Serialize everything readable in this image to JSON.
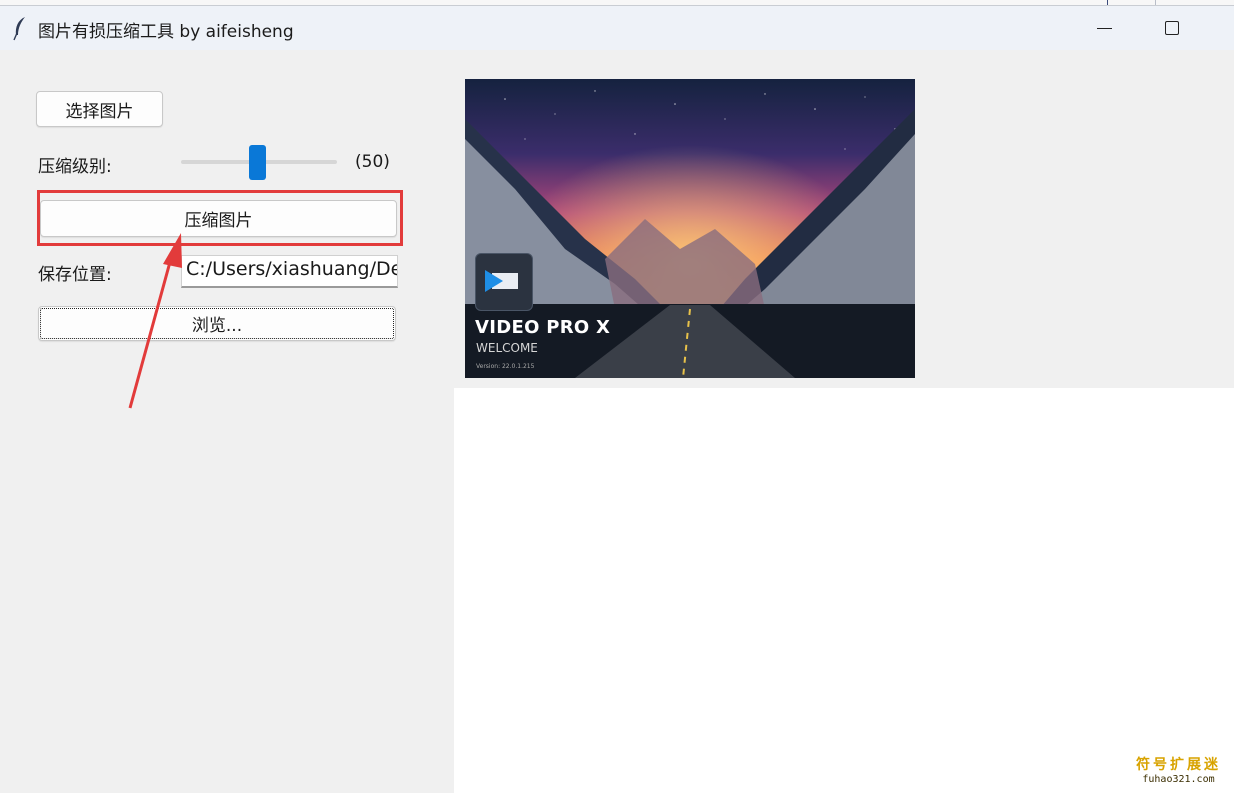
{
  "window": {
    "title": "图片有损压缩工具 by aifeisheng",
    "icon": "feather-icon"
  },
  "controls": {
    "select_button": "选择图片",
    "level_label": "压缩级别:",
    "level_value": "(50)",
    "level_fraction": 0.5,
    "compress_button": "压缩图片",
    "save_label": "保存位置:",
    "save_path": "C:/Users/xiashuang/Des",
    "browse_button": "浏览..."
  },
  "preview": {
    "title": "VIDEO PRO X",
    "subtitle": "WELCOME",
    "version": "Version: 22.0.1.215"
  },
  "watermark": {
    "line1": "符号扩展迷",
    "line2": "fuhao321.com"
  },
  "colors": {
    "annotation": "#e23b3b",
    "accent": "#0a78d7",
    "watermark": "#d8a300"
  }
}
